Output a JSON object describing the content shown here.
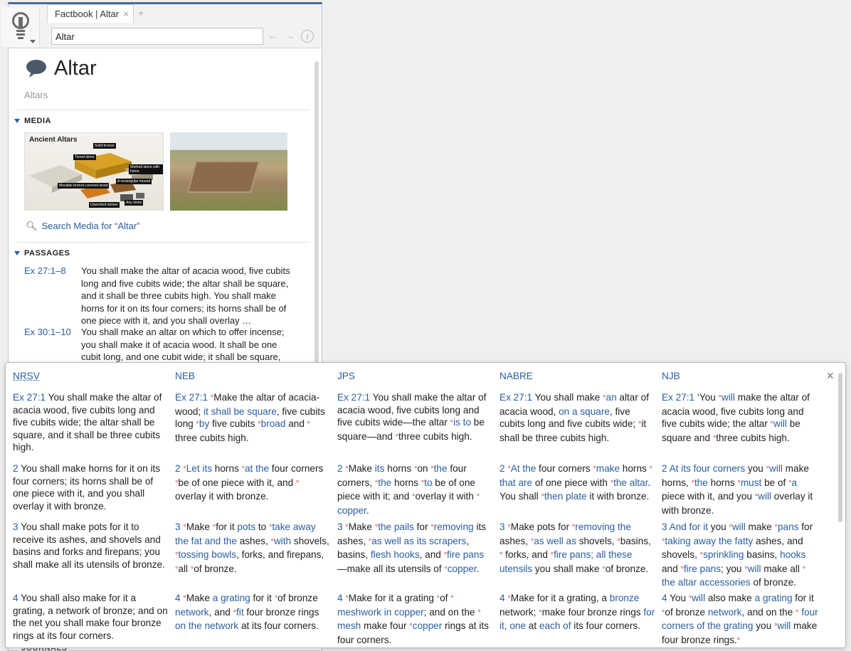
{
  "factbook": {
    "tab_title": "Factbook | Altar",
    "tab_close": "×",
    "new_tab": "+",
    "search_value": "Altar",
    "back": "←",
    "forward": "→",
    "info": "i",
    "title": "Altar",
    "subtitle": "Altars",
    "media_heading": "MEDIA",
    "media_image_label": "Ancient Altars",
    "media_image_tags": [
      "Solid bronze",
      "Tiered stone",
      "Worked stone with horns",
      "A rectangular mound",
      "Movable bronze-covered wood",
      "Unworked stones",
      "Any stone"
    ],
    "search_media": "Search Media for “Altar”",
    "passages_heading": "PASSAGES",
    "passages": [
      {
        "ref": "Ex 27:1–8",
        "text": "You shall make the altar of acacia wood, five cubits long and five cubits wide; the altar shall be square, and it shall be three cubits high. You shall make horns for it on its four corners; its horns shall be of one piece with it, and you shall overlay …"
      },
      {
        "ref": "Ex 30:1–10",
        "text": "You shall make an altar on which to offer incense; you shall make it of acacia wood. It shall be one cubit long, and one cubit wide; it shall be square,"
      }
    ],
    "journals_heading": "JOURNALS"
  },
  "popup": {
    "close": "×",
    "versions": [
      "NRSV",
      "NEB",
      "JPS",
      "NABRE",
      "NJB"
    ],
    "active_version": "NRSV"
  }
}
